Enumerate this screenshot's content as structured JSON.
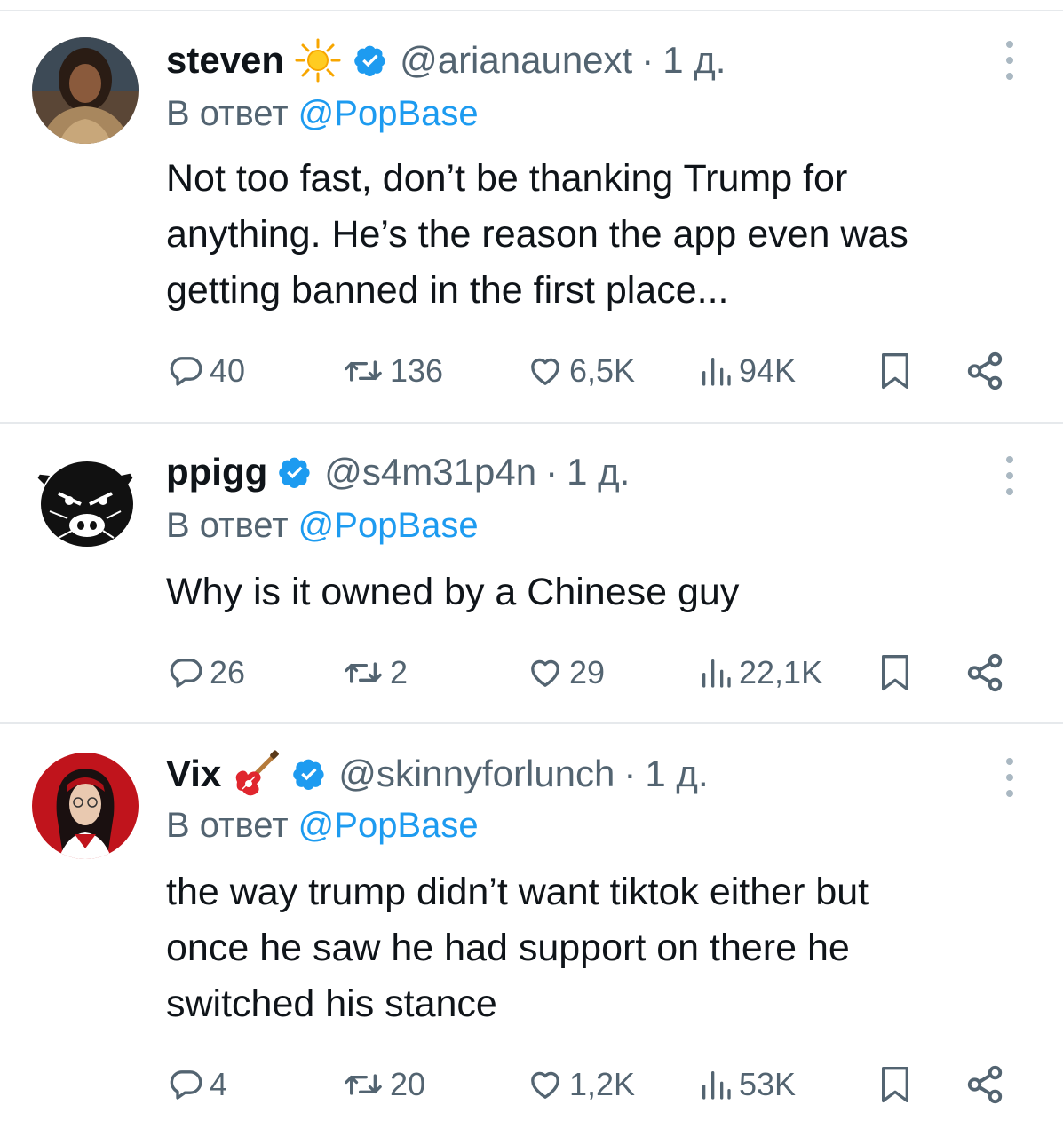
{
  "tweets": [
    {
      "name": "steven",
      "name_emoji": "sun-emoji",
      "handle": "@arianaunext",
      "separator": "·",
      "time": "1 д.",
      "reply_prefix": "В ответ",
      "reply_to": "@PopBase",
      "text_lines": [
        "Not too fast, don’t be thanking Trump for",
        "anything. He’s the reason the app even was",
        "getting banned in the first place..."
      ],
      "replies": "40",
      "reposts": "136",
      "likes": "6,5K",
      "views": "94K"
    },
    {
      "name": "ppigg",
      "handle": "@s4m31p4n",
      "separator": "·",
      "time": "1 д.",
      "reply_prefix": "В ответ",
      "reply_to": "@PopBase",
      "text_lines": [
        "Why is it owned by a Chinese guy"
      ],
      "replies": "26",
      "reposts": "2",
      "likes": "29",
      "views": "22,1K"
    },
    {
      "name": "Vix",
      "name_emoji": "guitar-emoji",
      "handle": "@skinnyforlunch",
      "separator": "·",
      "time": "1 д.",
      "reply_prefix": "В ответ",
      "reply_to": "@PopBase",
      "text_lines": [
        "the way trump didn’t want tiktok either but",
        "once he saw he had support on there he",
        "switched his stance"
      ],
      "replies": "4",
      "reposts": "20",
      "likes": "1,2K",
      "views": "53K"
    }
  ],
  "colors": {
    "verified": "#1d9bf0",
    "mention": "#1d9bf0",
    "secondary_text": "#536471",
    "primary_text": "#0f1419",
    "divider": "#e6e9ec"
  },
  "icons": [
    "reply-icon",
    "repost-icon",
    "like-icon",
    "views-icon",
    "bookmark-icon",
    "share-icon",
    "more-icon",
    "verified-badge-icon"
  ]
}
